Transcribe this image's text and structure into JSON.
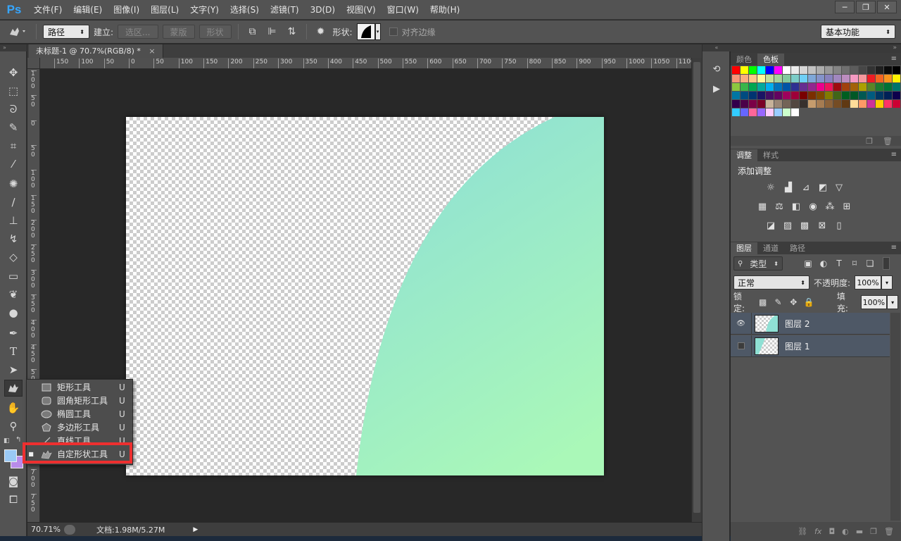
{
  "app": {
    "logo": "Ps"
  },
  "menu": [
    "文件(F)",
    "编辑(E)",
    "图像(I)",
    "图层(L)",
    "文字(Y)",
    "选择(S)",
    "滤镜(T)",
    "3D(D)",
    "视图(V)",
    "窗口(W)",
    "帮助(H)"
  ],
  "window_controls": {
    "minimize": "─",
    "restore": "❐",
    "close": "✕"
  },
  "options": {
    "tool_icon": "custom-shape-icon",
    "mode_select": "路径",
    "make_label": "建立:",
    "selection_button": "选区...",
    "mask_button": "蒙版",
    "shape_button": "形状",
    "shape_label": "形状:",
    "align_edges_label": "对齐边缘",
    "workspace_select": "基本功能"
  },
  "document": {
    "tab_title": "未标题-1 @ 70.7%(RGB/8) *",
    "close": "×",
    "shape_gradient": {
      "from": "#8fe0d4",
      "to": "#aaf8b8"
    }
  },
  "ruler": {
    "top_labels": [
      "150",
      "100",
      "50",
      "0",
      "50",
      "100",
      "150",
      "200",
      "250",
      "300",
      "350",
      "400",
      "450",
      "500",
      "550",
      "600",
      "650",
      "700",
      "750",
      "800",
      "850",
      "900",
      "950",
      "1000",
      "1050",
      "1100"
    ],
    "left_labels": [
      "100",
      "50",
      "0",
      "50",
      "100",
      "150",
      "200",
      "250",
      "300",
      "350",
      "400",
      "450",
      "500",
      "550",
      "600",
      "650",
      "700",
      "750"
    ]
  },
  "status": {
    "zoom": "70.71%",
    "doc_info": "文档:1.98M/5.27M",
    "arrow": "▶"
  },
  "toolbar": {
    "colors": {
      "foreground": "#9ac9f5",
      "background": "#b88bea"
    }
  },
  "flyout": {
    "items": [
      {
        "label": "矩形工具",
        "key": "U",
        "icon": "rectangle-icon",
        "selected": false
      },
      {
        "label": "圆角矩形工具",
        "key": "U",
        "icon": "rounded-rectangle-icon",
        "selected": false
      },
      {
        "label": "椭圆工具",
        "key": "U",
        "icon": "ellipse-icon",
        "selected": false
      },
      {
        "label": "多边形工具",
        "key": "U",
        "icon": "polygon-icon",
        "selected": false
      },
      {
        "label": "直线工具",
        "key": "U",
        "icon": "line-icon",
        "selected": false
      },
      {
        "label": "自定形状工具",
        "key": "U",
        "icon": "custom-shape-icon",
        "selected": true
      }
    ],
    "selected_bullet": "■",
    "highlight_color": "#ee2f2f"
  },
  "panels": {
    "swatches_tabs": [
      "颜色",
      "色板"
    ],
    "adjust_tabs": [
      "调整",
      "样式"
    ],
    "adjust_title": "添加调整",
    "layers_tabs": [
      "图层",
      "通道",
      "路径"
    ],
    "filter_select": "类型",
    "blend_select": "正常",
    "opacity_label": "不透明度:",
    "opacity_value": "100%",
    "lock_label": "锁定:",
    "fill_label": "填充:",
    "fill_value": "100%",
    "layers": [
      {
        "name": "图层 2",
        "visible": true
      },
      {
        "name": "图层 1",
        "visible": false
      }
    ]
  },
  "swatch_colors": [
    "#ff0000",
    "#ffff00",
    "#00ff00",
    "#00ffff",
    "#0000ff",
    "#ff00ff",
    "#ffffff",
    "#ebebeb",
    "#d6d6d6",
    "#c2c2c2",
    "#adadad",
    "#999999",
    "#858585",
    "#707070",
    "#5c5c5c",
    "#474747",
    "#333333",
    "#1f1f1f",
    "#0a0a0a",
    "#000000",
    "#f7977a",
    "#f9ad81",
    "#fdc68a",
    "#fff79a",
    "#c4df9b",
    "#a3d39c",
    "#82ca9d",
    "#7bcdc8",
    "#6ecff6",
    "#7ea7d8",
    "#8493ca",
    "#8882be",
    "#a187be",
    "#bc8dbf",
    "#f49ac2",
    "#f6989d",
    "#ed1c24",
    "#f26522",
    "#f7941d",
    "#fff200",
    "#8dc73f",
    "#39b54a",
    "#00a651",
    "#00a99d",
    "#00aeef",
    "#0072bc",
    "#0054a6",
    "#2e3192",
    "#662d91",
    "#92278f",
    "#ec008c",
    "#ed145b",
    "#9e0b0f",
    "#a0410d",
    "#a36209",
    "#aba000",
    "#598527",
    "#1a7b30",
    "#007236",
    "#00746b",
    "#0076a3",
    "#004b80",
    "#003471",
    "#1b1464",
    "#440e62",
    "#630460",
    "#9e005d",
    "#9e0039",
    "#790000",
    "#7b2e00",
    "#7d4900",
    "#827b00",
    "#406618",
    "#005e20",
    "#005826",
    "#005952",
    "#005b7f",
    "#003663",
    "#002157",
    "#0d004c",
    "#32004b",
    "#4b0049",
    "#7b0046",
    "#7a0026",
    "#c7b299",
    "#998675",
    "#736357",
    "#534741",
    "#37302d",
    "#c69c6d",
    "#a67c52",
    "#8c6239",
    "#754c24",
    "#603913",
    "#ffdd99",
    "#ff9966",
    "#cc3399",
    "#ffcc00",
    "#ff3366",
    "#cc0033",
    "#33ccff",
    "#6666ff",
    "#ff6699",
    "#9966ff",
    "#ffccff",
    "#99ccff",
    "#ccffcc",
    "#ffffff"
  ]
}
